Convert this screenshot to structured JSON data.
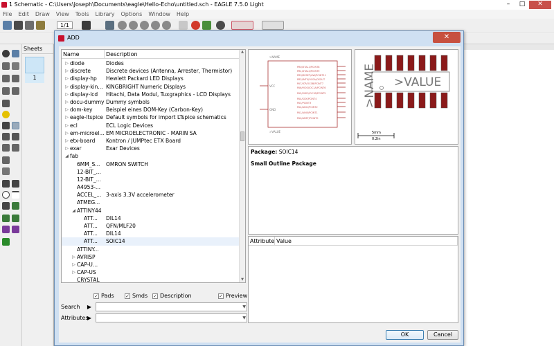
{
  "window": {
    "title": "1 Schematic - C:\\Users\\Joseph\\Documents\\eagle\\Hello-Echo\\untitled.sch - EAGLE 7.5.0 Light",
    "minimize": "–",
    "maximize": "□",
    "close": "✕"
  },
  "menu": [
    "File",
    "Edit",
    "Draw",
    "View",
    "Tools",
    "Library",
    "Options",
    "Window",
    "Help"
  ],
  "toolbar": {
    "zoom_value": "1/1"
  },
  "sheets": {
    "header": "Sheets",
    "sheet_number": "1"
  },
  "dialog": {
    "title": "ADD",
    "close": "✕",
    "columns": {
      "name": "Name",
      "description": "Description"
    },
    "tree": [
      {
        "name": "diode",
        "desc": "Diodes",
        "arrow": "▷",
        "indent": 0
      },
      {
        "name": "discrete",
        "desc": "Discrete devices (Antenna, Arrester, Thermistor)",
        "arrow": "▷",
        "indent": 0
      },
      {
        "name": "display-hp",
        "desc": "Hewlett Packard LED Displays",
        "arrow": "▷",
        "indent": 0
      },
      {
        "name": "display-kin...",
        "desc": "KINGBRIGHT Numeric Displays",
        "arrow": "▷",
        "indent": 0
      },
      {
        "name": "display-lcd",
        "desc": "Hitachi, Data Modul, Tuxgraphics - LCD Displays",
        "arrow": "▷",
        "indent": 0
      },
      {
        "name": "docu-dummy",
        "desc": "Dummy symbols",
        "arrow": "▷",
        "indent": 0
      },
      {
        "name": "dom-key",
        "desc": "Beispiel eines DOM-Key (Carbon-Key)",
        "arrow": "▷",
        "indent": 0
      },
      {
        "name": "eagle-ltspice",
        "desc": "Default symbols for import LTspice schematics",
        "arrow": "▷",
        "indent": 0
      },
      {
        "name": "ecl",
        "desc": "ECL Logic Devices",
        "arrow": "▷",
        "indent": 0
      },
      {
        "name": "em-microel...",
        "desc": "EM MICROELECTRONIC - MARIN SA",
        "arrow": "▷",
        "indent": 0
      },
      {
        "name": "etx-board",
        "desc": "Kontron / JUMPtec ETX Board",
        "arrow": "▷",
        "indent": 0
      },
      {
        "name": "exar",
        "desc": "Exar Devices",
        "arrow": "▷",
        "indent": 0
      },
      {
        "name": "fab",
        "desc": "",
        "arrow": "◢",
        "indent": 0
      },
      {
        "name": "6MM_S...",
        "desc": "OMRON SWITCH",
        "arrow": "",
        "indent": 1
      },
      {
        "name": "12-BIT_...",
        "desc": "",
        "arrow": "",
        "indent": 1
      },
      {
        "name": "12-BIT_...",
        "desc": "",
        "arrow": "",
        "indent": 1
      },
      {
        "name": "A4953-...",
        "desc": "",
        "arrow": "",
        "indent": 1
      },
      {
        "name": "ACCEL_...",
        "desc": "3-axis 3.3V accelerometer",
        "arrow": "",
        "indent": 1
      },
      {
        "name": "ATMEG...",
        "desc": "",
        "arrow": "",
        "indent": 1
      },
      {
        "name": "ATTINY44",
        "desc": "",
        "arrow": "◢",
        "indent": 1
      },
      {
        "name": "ATT...",
        "desc": "DIL14",
        "arrow": "",
        "indent": 2
      },
      {
        "name": "ATT...",
        "desc": "QFN/MLF20",
        "arrow": "",
        "indent": 2
      },
      {
        "name": "ATT...",
        "desc": "DIL14",
        "arrow": "",
        "indent": 2
      },
      {
        "name": "ATT...",
        "desc": "SOIC14",
        "arrow": "",
        "indent": 2,
        "selected": true
      },
      {
        "name": "ATTINY...",
        "desc": "",
        "arrow": "",
        "indent": 1
      },
      {
        "name": "AVRISP",
        "desc": "",
        "arrow": "▷",
        "indent": 1
      },
      {
        "name": "CAP-U...",
        "desc": "",
        "arrow": "▷",
        "indent": 1
      },
      {
        "name": "CAP-US",
        "desc": "",
        "arrow": "▷",
        "indent": 1
      },
      {
        "name": "CRYSTAL",
        "desc": "",
        "arrow": "",
        "indent": 1
      }
    ],
    "checkboxes": {
      "pads": "Pads",
      "smds": "Smds",
      "description": "Description",
      "preview": "Preview"
    },
    "search_label": "Search",
    "attributes_label": "Attributes",
    "package": {
      "label": "Package:",
      "value": "SOIC14",
      "description": "Small Outline Package"
    },
    "attr_columns": {
      "attribute": "Attribute",
      "value": "Value"
    },
    "pkg_preview": {
      "name_text": ">NAME",
      "value_text": ">VALUE",
      "scale_mm": "5mm",
      "scale_in": "0.2in"
    },
    "sym_preview": {
      "vcc": "VCC",
      "gnd": "GND",
      "name": ">NAME",
      "value": ">VALUE"
    },
    "ok": "OK",
    "cancel": "Cancel"
  }
}
